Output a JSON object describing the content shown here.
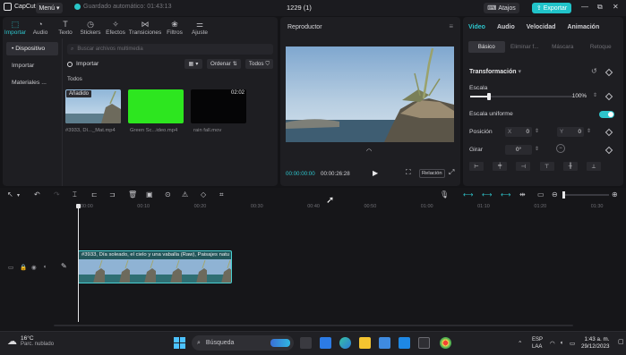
{
  "titlebar": {
    "app_name": "CapCut",
    "menu_label": "Menú",
    "autosave_text": "Guardado automático: 01:43:13",
    "project_title": "1229 (1)",
    "shortcuts_label": "Atajos",
    "export_label": "Exportar",
    "window_controls": [
      "—",
      "⧉",
      "✕"
    ]
  },
  "media": {
    "tabs": [
      {
        "label": "Importar",
        "icon": "import-icon"
      },
      {
        "label": "Audio",
        "icon": "audio-icon"
      },
      {
        "label": "Texto",
        "icon": "text-icon"
      },
      {
        "label": "Stickers",
        "icon": "stickers-icon"
      },
      {
        "label": "Efectos",
        "icon": "effects-icon"
      },
      {
        "label": "Transiciones",
        "icon": "transitions-icon"
      },
      {
        "label": "Filtros",
        "icon": "filters-icon"
      },
      {
        "label": "Ajuste",
        "icon": "adjust-icon"
      }
    ],
    "side_nav": [
      "• Dispositivo",
      "Importar",
      "Materiales ..."
    ],
    "search_placeholder": "Buscar archivos multimedia",
    "import_label": "Importar",
    "sort_label": "Ordenar",
    "filter_label": "Todos",
    "section_label": "Todos",
    "items": [
      {
        "caption": "#3933, Dí..._Mat.mp4",
        "badge": "Añadido",
        "duration": ""
      },
      {
        "caption": "Green Sc...ideo.mp4",
        "badge": "",
        "duration": ""
      },
      {
        "caption": "rain fall.mov",
        "badge": "",
        "duration": "02:02"
      }
    ]
  },
  "player": {
    "title": "Reproductor",
    "current_time": "00:00:00:00",
    "total_time": "00:00:26:28",
    "ratio_label": "Relación"
  },
  "properties": {
    "tabs": [
      "Video",
      "Audio",
      "Velocidad",
      "Animación"
    ],
    "sub_tabs": [
      "Básico",
      "Eliminar f...",
      "Máscara",
      "Retoque"
    ],
    "section": "Transformación",
    "scale_label": "Escala",
    "scale_value": "100%",
    "scale_fraction": 0.18,
    "uniform_label": "Escala uniforme",
    "position_label": "Posición",
    "pos_x_label": "X",
    "pos_x": "0",
    "pos_y_label": "Y",
    "pos_y": "0",
    "rotate_label": "Girar",
    "rotate_value": "0°"
  },
  "timeline": {
    "ruler": [
      "00:00",
      "00:10",
      "00:20",
      "00:30",
      "00:40",
      "00:50",
      "01:00",
      "01:10",
      "01:20",
      "01:30"
    ],
    "clip_label": "#3933, Día soleado, el cielo y una vaballa (Raw), Paisajes natu"
  },
  "taskbar": {
    "temp": "16°C",
    "weather": "Parc. nublado",
    "search_label": "Búsqueda",
    "lang_line1": "ESP",
    "lang_line2": "LAA",
    "time": "1:43 a. m.",
    "date": "29/12/2023"
  },
  "colors": {
    "accent": "#2ec5cc",
    "export": "#21c3c9",
    "clip_border": "#49d0d2"
  }
}
